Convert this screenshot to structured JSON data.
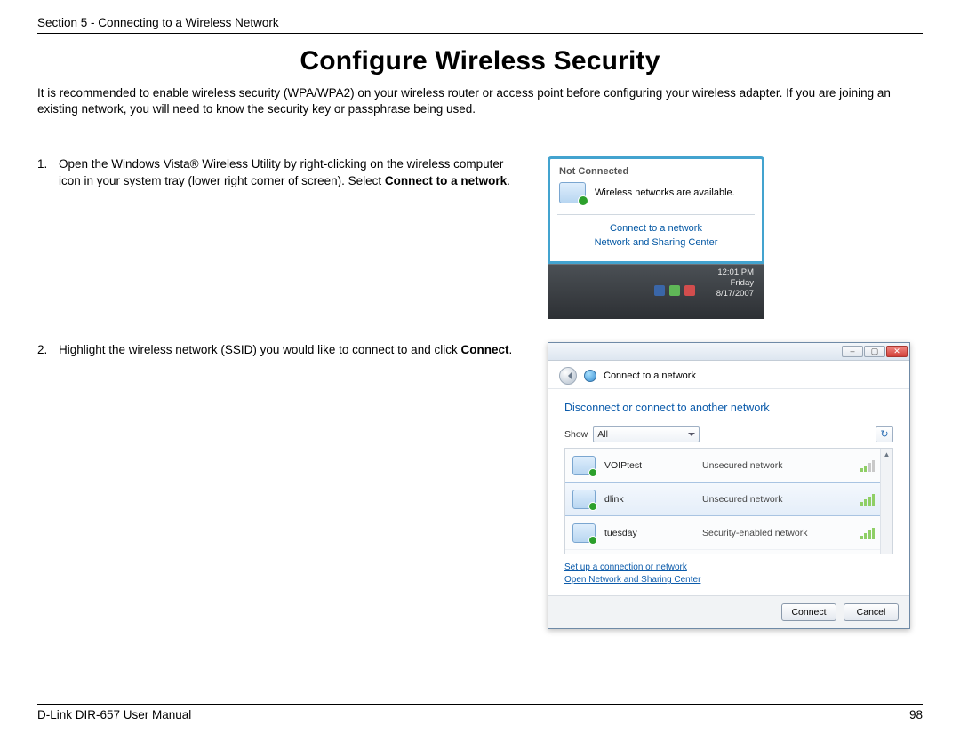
{
  "header": {
    "section": "Section 5 - Connecting to a Wireless Network"
  },
  "title": "Configure Wireless Security",
  "intro": "It is recommended to enable wireless security (WPA/WPA2) on your wireless router or access point before configuring your wireless adapter. If you are joining an existing network, you will need to know the security key or passphrase being used.",
  "steps": {
    "one": {
      "num": "1.",
      "text_a": "Open the Windows Vista® Wireless Utility by right-clicking on the wireless computer icon in your system tray (lower right corner of screen). Select ",
      "bold": "Connect to a network",
      "text_b": "."
    },
    "two": {
      "num": "2.",
      "text_a": "Highlight the wireless network (SSID) you would like to connect to and click ",
      "bold": "Connect",
      "text_b": "."
    }
  },
  "shot1": {
    "status": "Not Connected",
    "available": "Wireless networks are available.",
    "link1": "Connect to a network",
    "link2": "Network and Sharing Center",
    "clock_time": "12:01 PM",
    "clock_day": "Friday",
    "clock_date": "8/17/2007"
  },
  "shot2": {
    "title": "Connect to a network",
    "heading": "Disconnect or connect to another network",
    "show_label": "Show",
    "show_value": "All",
    "networks": [
      {
        "ssid": "VOIPtest",
        "type": "Unsecured network"
      },
      {
        "ssid": "dlink",
        "type": "Unsecured network"
      },
      {
        "ssid": "tuesday",
        "type": "Security-enabled network"
      }
    ],
    "link1": "Set up a connection or network",
    "link2": "Open Network and Sharing Center",
    "btn_connect": "Connect",
    "btn_cancel": "Cancel"
  },
  "footer": {
    "left": "D-Link DIR-657 User Manual",
    "right": "98"
  }
}
